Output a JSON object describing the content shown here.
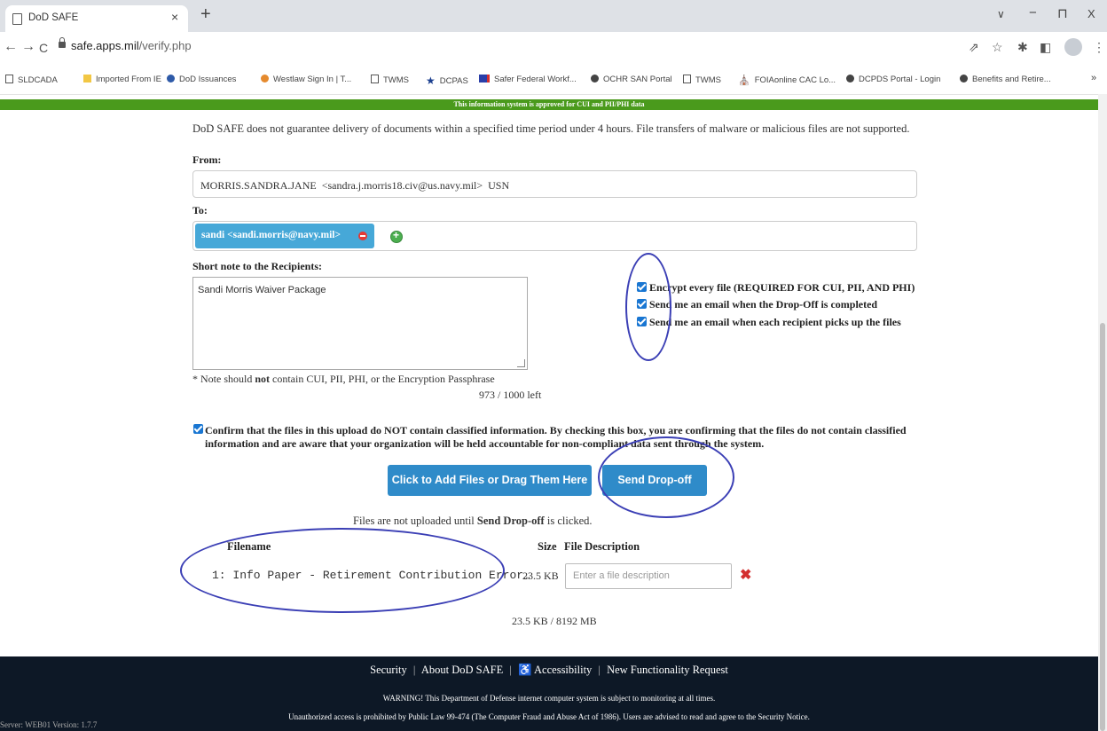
{
  "browser": {
    "tab_title": "DoD SAFE",
    "tab_close": "×",
    "new_tab": "+",
    "url_host": "safe.apps.mil",
    "url_path": "/verify.php",
    "icons": [
      "back-icon",
      "forward-icon",
      "reload-icon",
      "lock-icon",
      "share-icon",
      "star-icon",
      "extensions-icon",
      "sidepanel-icon",
      "profile-icon",
      "menu-icon"
    ],
    "window_controls": {
      "chevron": "∨",
      "minimize": "−",
      "maximize": "⊓",
      "close": "X"
    },
    "nav": {
      "back": "←",
      "forward": "→",
      "reload": "C"
    },
    "right_icons": {
      "share": "⇗",
      "star": "☆",
      "ext": "✱",
      "side": "◧",
      "menu": "⋮"
    },
    "bookmarks": [
      {
        "label": "SLDCADA",
        "color": "#555555"
      },
      {
        "label": "Imported From IE",
        "color": "#f2c744"
      },
      {
        "label": "DoD Issuances",
        "color": "#2e5aa8"
      },
      {
        "label": "Westlaw Sign In | T...",
        "color": "#e58a2e"
      },
      {
        "label": "TWMS",
        "color": "#555555"
      },
      {
        "label": "DCPAS",
        "color": "#1b3f8f"
      },
      {
        "label": "Safer Federal Workf...",
        "color": "#2a3ea8"
      },
      {
        "label": "OCHR SAN Portal",
        "color": "#444444"
      },
      {
        "label": "TWMS",
        "color": "#555555"
      },
      {
        "label": "FOIAonline CAC Lo...",
        "color": "#222222"
      },
      {
        "label": "DCPDS Portal - Login",
        "color": "#444444"
      },
      {
        "label": "Benefits and Retire...",
        "color": "#444444"
      }
    ],
    "bookmarks_more": "»"
  },
  "banner": "This information system is approved for CUI and PII/PHI data",
  "disclaimer": "DoD SAFE does not guarantee delivery of documents within a specified time period under 4 hours. File transfers of malware or malicious files are not supported.",
  "form": {
    "from_label": "From:",
    "from_value": "MORRIS.SANDRA.JANE  <sandra.j.morris18.civ@us.navy.mil>  USN",
    "to_label": "To:",
    "recipient_chip": "sandi <sandi.morris@navy.mil>",
    "note_label": "Short note to the Recipients:",
    "note_value": "Sandi Morris Waiver Package",
    "note_hint_pre": "* Note should ",
    "note_hint_bold": "not",
    "note_hint_post": " contain CUI, PII, PHI, or the Encryption Passphrase",
    "note_counter": "973 / 1000 left",
    "options": [
      {
        "label": "Encrypt every file (REQUIRED FOR CUI, PII, AND PHI)",
        "checked": true
      },
      {
        "label": "Send me an email when the Drop-Off is completed",
        "checked": true
      },
      {
        "label": "Send me an email when each recipient picks up the files",
        "checked": true
      }
    ],
    "confirm_text": "Confirm that the files in this upload do NOT contain classified information. By checking this box, you are confirming that the files do not contain classified information and are aware that your organization will be held accountable for non-compliant data sent through the system.",
    "add_files_button": "Click to Add Files or Drag Them Here",
    "send_button": "Send Drop-off",
    "upload_note_pre": "Files are not uploaded until ",
    "upload_note_bold": "Send Drop-off",
    "upload_note_post": " is clicked."
  },
  "files": {
    "headers": {
      "filename": "Filename",
      "size": "Size",
      "description": "File Description"
    },
    "rows": [
      {
        "name": "1: Info Paper - Retirement Contribution Error…",
        "size": "23.5 KB",
        "description_placeholder": "Enter a file description",
        "delete": "✖"
      }
    ],
    "total": "23.5 KB / 8192 MB"
  },
  "footer": {
    "links": [
      "Security",
      "About DoD SAFE",
      "Accessibility",
      "New Functionality Request"
    ],
    "accessibility_symbol": "♿",
    "separator": "|",
    "warning": "WARNING! This Department of Defense internet computer system is subject to monitoring at all times.",
    "notice": "Unauthorized access is prohibited by Public Law 99-474 (The Computer Fraud and Abuse Act of 1986). Users are advised to read and agree to the Security Notice."
  },
  "server_info": "Server: WEB01    Version: 1.7.7",
  "annotation_color": "#3b3fb5",
  "accent_color": "#2f8bc9",
  "banner_color": "#4a9a1c"
}
